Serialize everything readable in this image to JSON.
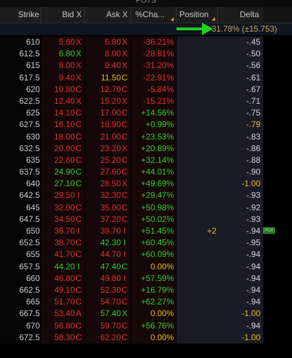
{
  "window": {
    "title": "POTS"
  },
  "columns": {
    "strike": "Strike",
    "bid": "Bid X",
    "ask": "Ask X",
    "change": "%Cha...",
    "position": "Position",
    "delta": "Delta"
  },
  "summary": {
    "value": "31.78% (±15.753)",
    "color": "#c9a55a",
    "arrow_color": "#22d11f"
  },
  "colors": {
    "red": "#e0312b",
    "green": "#2fd12f",
    "yellow": "#e3c21a",
    "white": "#d8d8d8"
  },
  "rows": [
    {
      "strike": "610",
      "bid": "5.60",
      "bid_ex": "X",
      "bid_c": "red",
      "ask": "6.80",
      "ask_ex": "X",
      "ask_c": "red",
      "chg": "-36.21%",
      "chg_c": "red",
      "pos": "",
      "delta": "-.45",
      "delta_c": "white",
      "badge": ""
    },
    {
      "strike": "612.5",
      "bid": "6.80",
      "bid_ex": "X",
      "bid_c": "green",
      "ask": "8.00",
      "ask_ex": "X",
      "ask_c": "red",
      "chg": "-28.81%",
      "chg_c": "red",
      "pos": "",
      "delta": "-.50",
      "delta_c": "white",
      "badge": ""
    },
    {
      "strike": "615",
      "bid": "8.00",
      "bid_ex": "X",
      "bid_c": "red",
      "ask": "9.40",
      "ask_ex": "X",
      "ask_c": "red",
      "chg": "-31.20%",
      "chg_c": "red",
      "pos": "",
      "delta": "-.56",
      "delta_c": "white",
      "badge": ""
    },
    {
      "strike": "617.5",
      "bid": "9.40",
      "bid_ex": "X",
      "bid_c": "red",
      "ask": "11.50",
      "ask_ex": "C",
      "ask_c": "yellow",
      "chg": "-22.91%",
      "chg_c": "red",
      "pos": "",
      "delta": "-.61",
      "delta_c": "white",
      "badge": ""
    },
    {
      "strike": "620",
      "bid": "10.80",
      "bid_ex": "C",
      "bid_c": "red",
      "ask": "12.70",
      "ask_ex": "C",
      "ask_c": "red",
      "chg": "-5.84%",
      "chg_c": "red",
      "pos": "",
      "delta": "-.67",
      "delta_c": "white",
      "badge": ""
    },
    {
      "strike": "622.5",
      "bid": "12.40",
      "bid_ex": "X",
      "bid_c": "red",
      "ask": "15.20",
      "ask_ex": "X",
      "ask_c": "red",
      "chg": "-15.21%",
      "chg_c": "red",
      "pos": "",
      "delta": "-.71",
      "delta_c": "white",
      "badge": ""
    },
    {
      "strike": "625",
      "bid": "14.10",
      "bid_ex": "C",
      "bid_c": "red",
      "ask": "17.00",
      "ask_ex": "C",
      "ask_c": "red",
      "chg": "+14.56%",
      "chg_c": "green",
      "pos": "",
      "delta": "-.75",
      "delta_c": "white",
      "badge": ""
    },
    {
      "strike": "627.5",
      "bid": "16.10",
      "bid_ex": "C",
      "bid_c": "red",
      "ask": "18.90",
      "ask_ex": "C",
      "ask_c": "red",
      "chg": "+0.99%",
      "chg_c": "green",
      "pos": "",
      "delta": "-.79",
      "delta_c": "yellow",
      "badge": ""
    },
    {
      "strike": "630",
      "bid": "18.00",
      "bid_ex": "C",
      "bid_c": "red",
      "ask": "21.00",
      "ask_ex": "C",
      "ask_c": "red",
      "chg": "+23.53%",
      "chg_c": "green",
      "pos": "",
      "delta": "-.83",
      "delta_c": "white",
      "badge": ""
    },
    {
      "strike": "632.5",
      "bid": "20.00",
      "bid_ex": "C",
      "bid_c": "red",
      "ask": "23.20",
      "ask_ex": "X",
      "ask_c": "red",
      "chg": "+20.89%",
      "chg_c": "green",
      "pos": "",
      "delta": "-.86",
      "delta_c": "white",
      "badge": ""
    },
    {
      "strike": "635",
      "bid": "22.60",
      "bid_ex": "C",
      "bid_c": "red",
      "ask": "25.20",
      "ask_ex": "C",
      "ask_c": "red",
      "chg": "+32.14%",
      "chg_c": "green",
      "pos": "",
      "delta": "-.88",
      "delta_c": "white",
      "badge": ""
    },
    {
      "strike": "637.5",
      "bid": "24.90",
      "bid_ex": "C",
      "bid_c": "green",
      "ask": "27.60",
      "ask_ex": "C",
      "ask_c": "red",
      "chg": "+44.01%",
      "chg_c": "green",
      "pos": "",
      "delta": "-.90",
      "delta_c": "white",
      "badge": ""
    },
    {
      "strike": "640",
      "bid": "27.10",
      "bid_ex": "C",
      "bid_c": "green",
      "ask": "28.50",
      "ask_ex": "X",
      "ask_c": "red",
      "chg": "+49.69%",
      "chg_c": "green",
      "pos": "",
      "delta": "-1.00",
      "delta_c": "yellow",
      "badge": ""
    },
    {
      "strike": "642.5",
      "bid": "29.50",
      "bid_ex": "I",
      "bid_c": "red",
      "ask": "32.30",
      "ask_ex": "C",
      "ask_c": "red",
      "chg": "+29.47%",
      "chg_c": "green",
      "pos": "",
      "delta": "-.93",
      "delta_c": "white",
      "badge": ""
    },
    {
      "strike": "645",
      "bid": "32.00",
      "bid_ex": "C",
      "bid_c": "red",
      "ask": "35.00",
      "ask_ex": "C",
      "ask_c": "red",
      "chg": "+50.98%",
      "chg_c": "green",
      "pos": "",
      "delta": "-.92",
      "delta_c": "white",
      "badge": ""
    },
    {
      "strike": "647.5",
      "bid": "34.50",
      "bid_ex": "C",
      "bid_c": "red",
      "ask": "37.20",
      "ask_ex": "C",
      "ask_c": "red",
      "chg": "+50.02%",
      "chg_c": "green",
      "pos": "",
      "delta": "-.93",
      "delta_c": "white",
      "badge": ""
    },
    {
      "strike": "650",
      "bid": "36.70",
      "bid_ex": "I",
      "bid_c": "red",
      "ask": "39.70",
      "ask_ex": "I",
      "ask_c": "red",
      "chg": "+51.45%",
      "chg_c": "green",
      "pos": "+2",
      "delta": "-.94",
      "delta_c": "white",
      "badge": "POS"
    },
    {
      "strike": "652.5",
      "bid": "38.70",
      "bid_ex": "C",
      "bid_c": "red",
      "ask": "42.30",
      "ask_ex": "I",
      "ask_c": "green",
      "chg": "+60.45%",
      "chg_c": "green",
      "pos": "",
      "delta": "-.95",
      "delta_c": "white",
      "badge": ""
    },
    {
      "strike": "655",
      "bid": "41.70",
      "bid_ex": "C",
      "bid_c": "red",
      "ask": "44.70",
      "ask_ex": "I",
      "ask_c": "red",
      "chg": "+60.09%",
      "chg_c": "green",
      "pos": "",
      "delta": "-.94",
      "delta_c": "white",
      "badge": ""
    },
    {
      "strike": "657.5",
      "bid": "44.20",
      "bid_ex": "I",
      "bid_c": "green",
      "ask": "47.40",
      "ask_ex": "C",
      "ask_c": "green",
      "chg": "0.00%",
      "chg_c": "yellow",
      "pos": "",
      "delta": "-.94",
      "delta_c": "white",
      "badge": ""
    },
    {
      "strike": "660",
      "bid": "46.80",
      "bid_ex": "C",
      "bid_c": "red",
      "ask": "49.80",
      "ask_ex": "I",
      "ask_c": "red",
      "chg": "+57.59%",
      "chg_c": "green",
      "pos": "",
      "delta": "-.94",
      "delta_c": "white",
      "badge": ""
    },
    {
      "strike": "662.5",
      "bid": "49.10",
      "bid_ex": "C",
      "bid_c": "red",
      "ask": "52.30",
      "ask_ex": "C",
      "ask_c": "red",
      "chg": "+16.79%",
      "chg_c": "green",
      "pos": "",
      "delta": "-.94",
      "delta_c": "white",
      "badge": ""
    },
    {
      "strike": "665",
      "bid": "51.70",
      "bid_ex": "C",
      "bid_c": "red",
      "ask": "54.70",
      "ask_ex": "C",
      "ask_c": "red",
      "chg": "+62.27%",
      "chg_c": "green",
      "pos": "",
      "delta": "-.94",
      "delta_c": "white",
      "badge": ""
    },
    {
      "strike": "667.5",
      "bid": "53.40",
      "bid_ex": "A",
      "bid_c": "red",
      "ask": "57.40",
      "ask_ex": "X",
      "ask_c": "green",
      "chg": "0.00%",
      "chg_c": "yellow",
      "pos": "",
      "delta": "-1.00",
      "delta_c": "yellow",
      "badge": ""
    },
    {
      "strike": "670",
      "bid": "56.80",
      "bid_ex": "C",
      "bid_c": "red",
      "ask": "59.70",
      "ask_ex": "C",
      "ask_c": "red",
      "chg": "+56.76%",
      "chg_c": "green",
      "pos": "",
      "delta": "-.94",
      "delta_c": "white",
      "badge": ""
    },
    {
      "strike": "672.5",
      "bid": "58.30",
      "bid_ex": "C",
      "bid_c": "red",
      "ask": "62.20",
      "ask_ex": "C",
      "ask_c": "red",
      "chg": "0.00%",
      "chg_c": "yellow",
      "pos": "",
      "delta": "-1.00",
      "delta_c": "yellow",
      "badge": ""
    }
  ]
}
